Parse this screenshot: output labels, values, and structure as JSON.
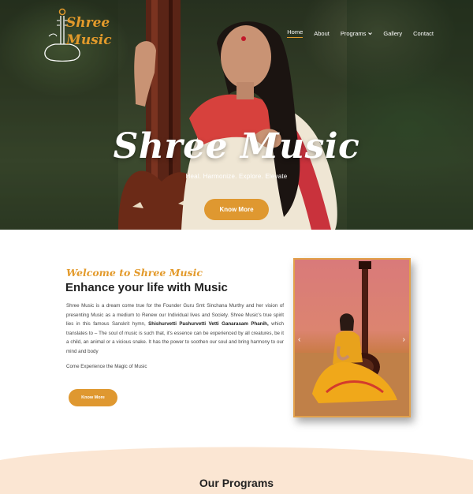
{
  "brand": {
    "name": "Shree Music"
  },
  "nav": {
    "items": [
      {
        "label": "Home",
        "active": true
      },
      {
        "label": "About"
      },
      {
        "label": "Programs",
        "has_dropdown": true
      },
      {
        "label": "Gallery"
      },
      {
        "label": "Contact"
      }
    ]
  },
  "hero": {
    "title": "Shree Music",
    "subtitle": "Heal. Harmonize. Explore. Elevate",
    "button_label": "Know More"
  },
  "welcome": {
    "kicker": "Welcome to Shree Music",
    "heading": "Enhance your life with Music",
    "body_part1": "Shree Music is a dream come true for the Founder Guru Smt Sinchana Murthy and her vision of presenting Music as a medium to Renew our Individual lives and Society. Shree Music's true spirit lies in this famous Sanskrit hymn, ",
    "body_bold": "Shishurvetti Pashurvetti Vetti Ganarasam Phanih,",
    "body_part2": " which translates to – The soul of music is such that, it's essence can be experienced by all  creatures, be it a child, an animal or a vicious snake. It has the power to soothen our soul and bring harmony to our mind and body",
    "extra_line": "Come Experience the Magic of Music",
    "button_label": "Know More"
  },
  "slider": {
    "prev_icon": "‹",
    "next_icon": "›"
  },
  "programs": {
    "heading": "Our Programs"
  },
  "colors": {
    "accent": "#df9830",
    "wave": "#fbe6d3",
    "heading": "#222222"
  }
}
